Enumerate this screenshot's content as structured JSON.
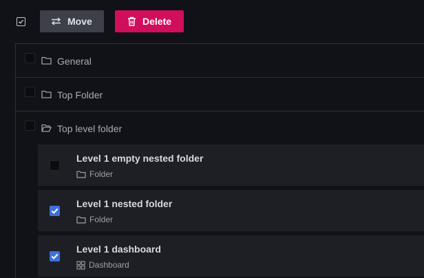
{
  "toolbar": {
    "move_label": "Move",
    "delete_label": "Delete"
  },
  "colors": {
    "background": "#111217",
    "delete_button": "#d10e5c",
    "move_button": "#3d4049",
    "checkbox_checked": "#3d71d9"
  },
  "folders": [
    {
      "label": "General",
      "icon": "folder-icon",
      "checked": false
    },
    {
      "label": "Top Folder",
      "icon": "folder-icon",
      "checked": false
    },
    {
      "label": "Top level folder",
      "icon": "folder-open-icon",
      "checked": false
    }
  ],
  "nested_items": [
    {
      "title": "Level 1 empty nested folder",
      "type": "Folder",
      "icon": "folder-icon",
      "checked": false
    },
    {
      "title": "Level 1 nested folder",
      "type": "Folder",
      "icon": "folder-icon",
      "checked": true
    },
    {
      "title": "Level 1 dashboard",
      "type": "Dashboard",
      "icon": "dashboard-grid-icon",
      "checked": true
    }
  ]
}
